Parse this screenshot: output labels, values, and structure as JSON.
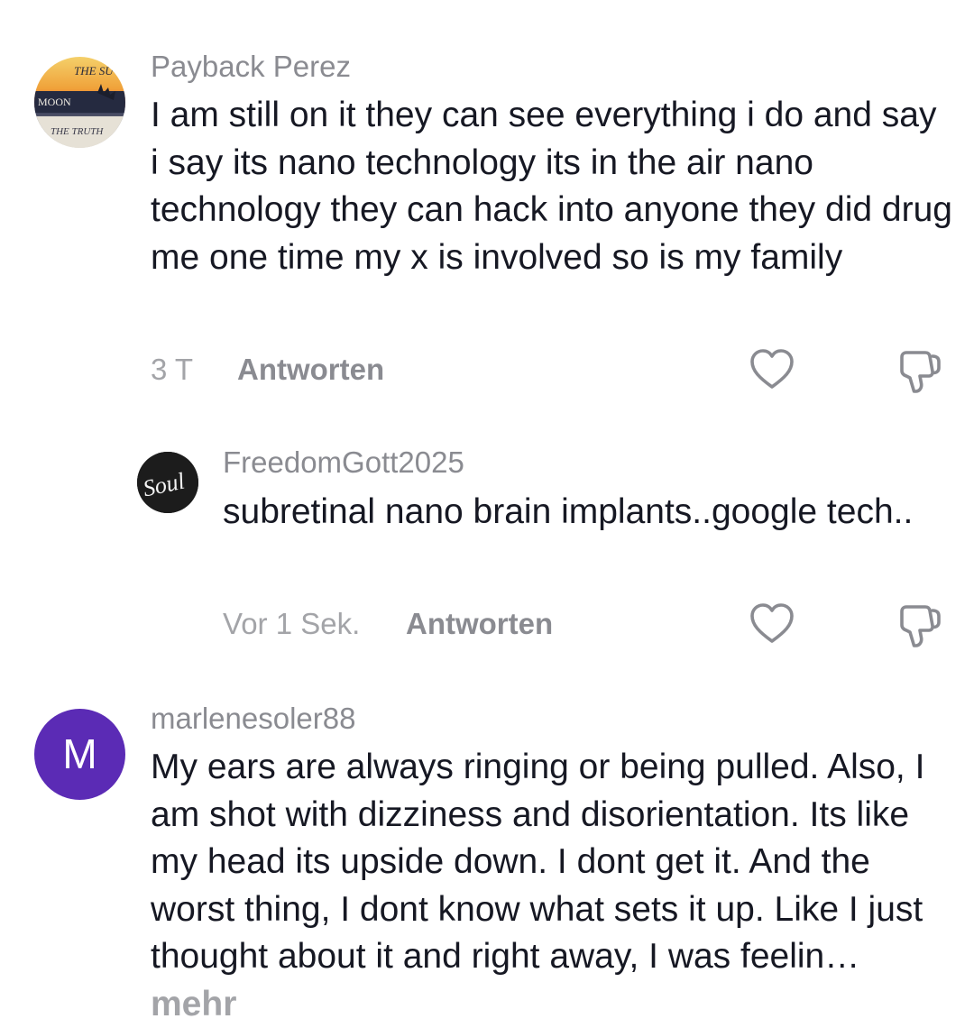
{
  "comments": [
    {
      "username": "Payback Perez",
      "avatar_icon": "sunset-moon-truth-avatar",
      "avatar_text": [
        "THE SU",
        "MOON",
        "THE TRUTH"
      ],
      "text": "I am still on it they can see everything i do and say i say its nano technology its in the air nano technology they can hack into anyone they did drug me one time my x is involved so is my family",
      "time": "3 T",
      "reply_label": "Antworten",
      "like_icon": "heart-outline-icon",
      "dislike_icon": "thumbs-down-outline-icon"
    },
    {
      "username": "FreedomGott2025",
      "avatar_icon": "soul-script-avatar",
      "avatar_text": "Soul",
      "text": "subretinal nano brain implants..google tech..",
      "time": "Vor 1 Sek.",
      "reply_label": "Antworten",
      "like_icon": "heart-outline-icon",
      "dislike_icon": "thumbs-down-outline-icon"
    },
    {
      "username": "marlenesoler88",
      "avatar_letter": "M",
      "avatar_color": "#5b2bb5",
      "text": "My ears are always ringing or being pulled. Also, I am shot with dizziness and disorientation. Its like my head its upside down. I dont get it. And the worst thing, I dont know what sets it up. Like I just thought about it and right away, I was feelin",
      "more_label": "mehr"
    }
  ],
  "colors": {
    "username": "#8a8b91",
    "text": "#161823",
    "time": "#a3a4a8",
    "avatar_m": "#5b2bb5"
  }
}
